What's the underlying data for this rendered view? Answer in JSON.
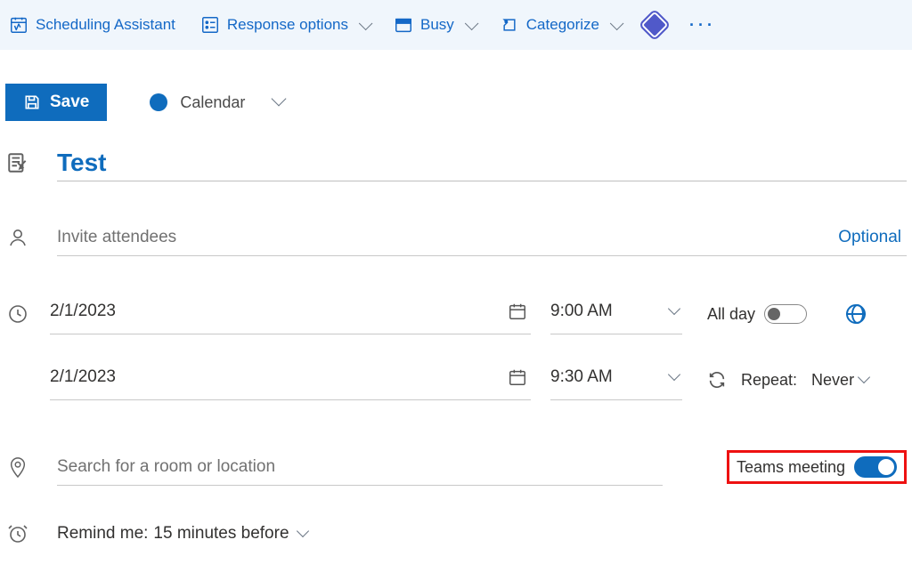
{
  "toolbar": {
    "scheduling_assistant": "Scheduling Assistant",
    "response_options": "Response options",
    "busy": "Busy",
    "categorize": "Categorize"
  },
  "actions": {
    "save_label": "Save",
    "calendar_label": "Calendar"
  },
  "event": {
    "title": "Test",
    "invite_placeholder": "Invite attendees",
    "optional_label": "Optional",
    "start_date": "2/1/2023",
    "start_time": "9:00 AM",
    "end_date": "2/1/2023",
    "end_time": "9:30 AM",
    "all_day_label": "All day",
    "all_day": false,
    "repeat_label": "Repeat:",
    "repeat_value": "Never",
    "location_placeholder": "Search for a room or location",
    "teams_label": "Teams meeting",
    "teams_on": true,
    "remind_label": "Remind me:",
    "remind_value": "15 minutes before"
  }
}
